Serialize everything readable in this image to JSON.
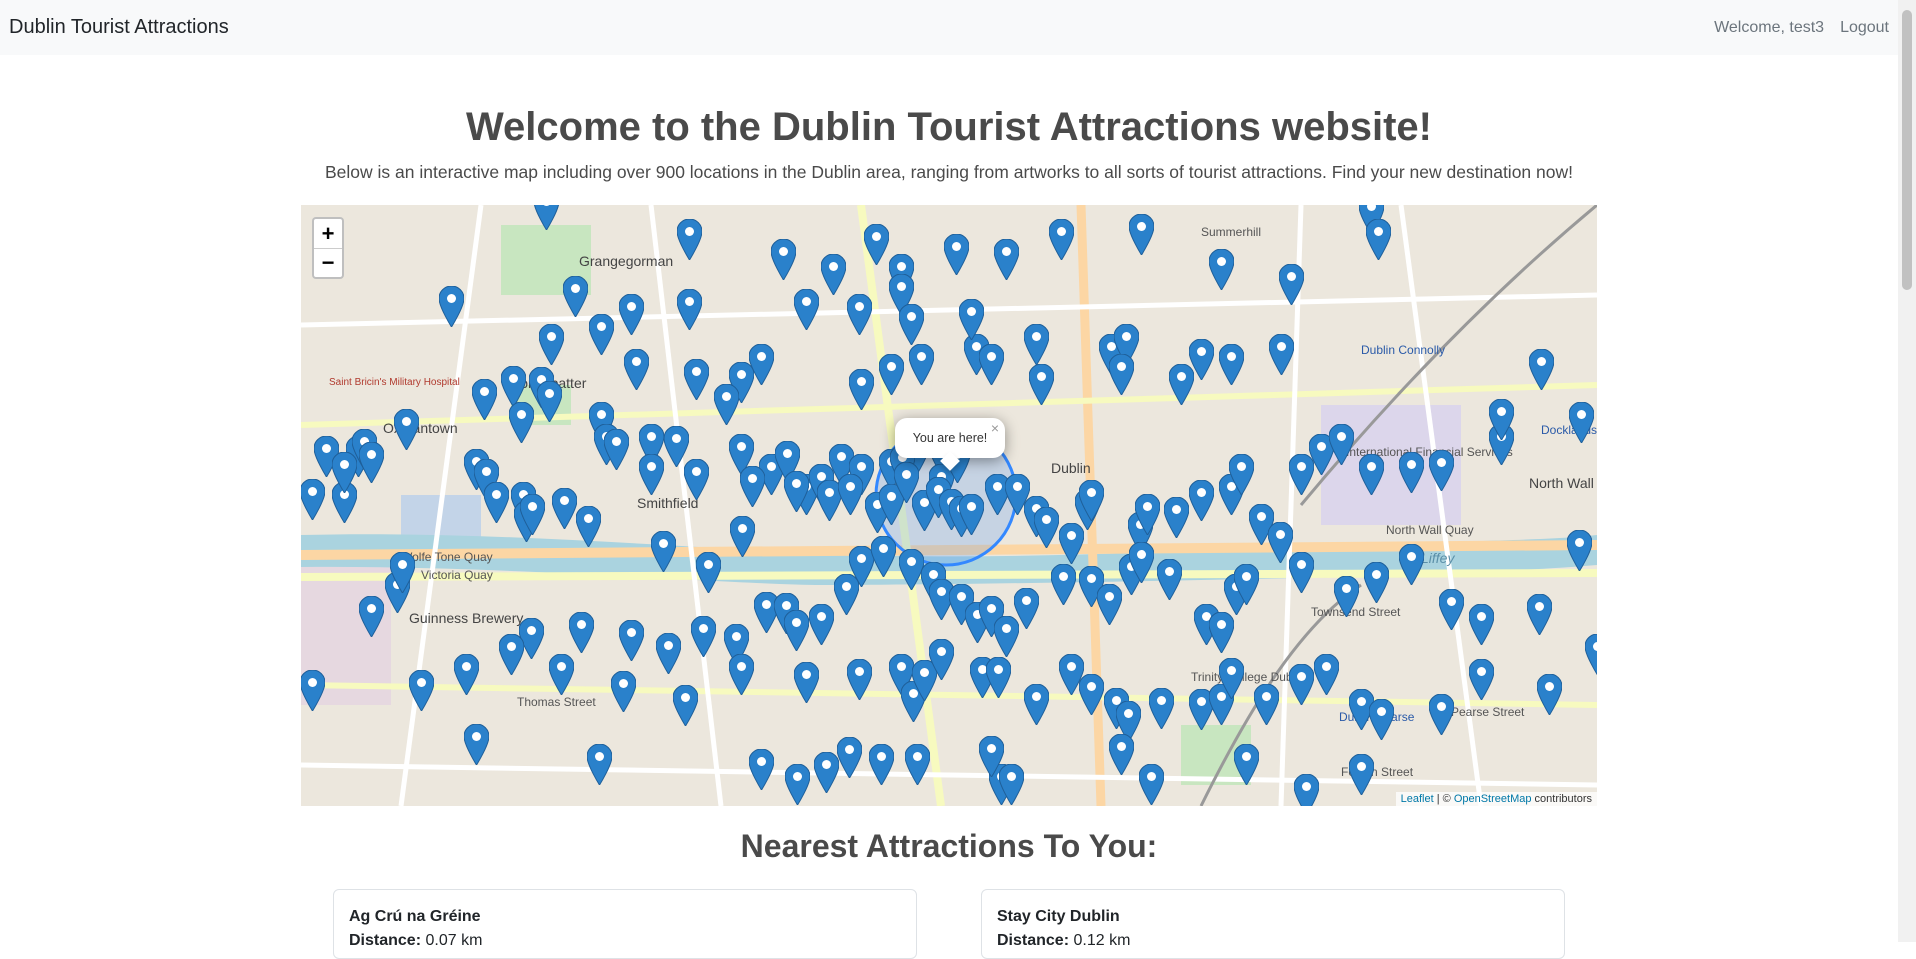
{
  "navbar": {
    "brand": "Dublin Tourist Attractions",
    "welcome": "Welcome, test3",
    "logout": "Logout"
  },
  "header": {
    "title": "Welcome to the Dublin Tourist Attractions website!",
    "subtitle": "Below is an interactive map including over 900 locations in the Dublin area, ranging from artworks to all sorts of tourist attractions. Find your new destination now!"
  },
  "map": {
    "zoom_in": "+",
    "zoom_out": "−",
    "popup_text": "You are here!",
    "popup_close": "×",
    "attribution_leaflet": "Leaflet",
    "attribution_sep": " | © ",
    "attribution_osm": "OpenStreetMap",
    "attribution_tail": " contributors",
    "marker_color": "#2a81cb",
    "labels": {
      "grangegorman": "Grangegorman",
      "stoneybatter": "Stoneybatter",
      "oxmantown": "Oxmantown",
      "smithfield": "Smithfield",
      "wolfe_tone_quay": "Wolfe Tone Quay",
      "victoria_quay": "Victoria Quay",
      "guinness_brewery": "Guinness Brewery",
      "dublin": "Dublin",
      "dublin_connolly": "Dublin Connolly",
      "ifsc": "International Financial Services",
      "north_wall": "North Wall",
      "north_wall_quay": "North Wall Quay",
      "liffey": "Liffey",
      "trinity": "Trinity College Dublin",
      "dublin_pearse": "Dublin Pearse",
      "pearse_street": "Pearse Street",
      "thomas_street": "Thomas Street",
      "summerhill": "Summerhill",
      "docklands": "Docklands",
      "fenian_street": "Fenian Street",
      "townsend_street": "Townsend Street",
      "st_bricins": "Saint Bricin's Military Hospital"
    }
  },
  "nearest": {
    "heading": "Nearest Attractions To You:",
    "cards": [
      {
        "name": "Ag Crú na Gréine",
        "distance_label": "Distance:",
        "distance": "0.07 km"
      },
      {
        "name": "Stay City Dublin",
        "distance_label": "Distance:",
        "distance": "0.12 km"
      }
    ]
  }
}
